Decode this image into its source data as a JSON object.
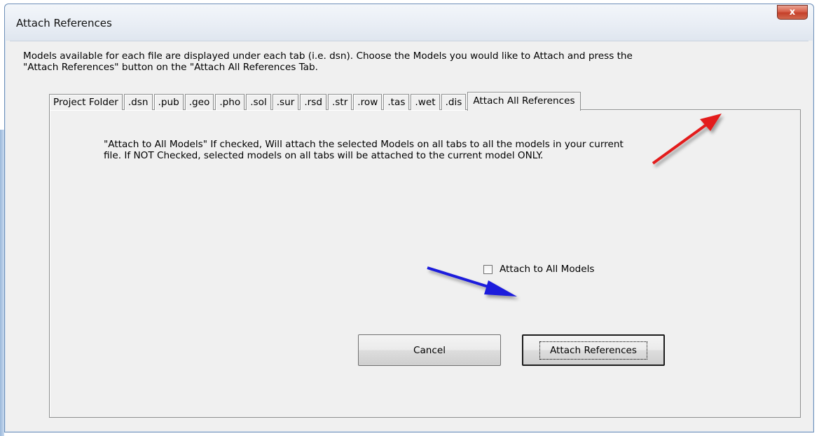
{
  "window": {
    "title": "Attach References",
    "close_label": "x"
  },
  "instructions": "Models available for each file are displayed under each tab (i.e. dsn).  Choose the Models you would like to Attach and press the\n\"Attach References\" button on the \"Attach All References Tab.",
  "tabs": [
    {
      "label": "Project Folder"
    },
    {
      "label": ".dsn"
    },
    {
      "label": ".pub"
    },
    {
      "label": ".geo"
    },
    {
      "label": ".pho"
    },
    {
      "label": ".sol"
    },
    {
      "label": ".sur"
    },
    {
      "label": ".rsd"
    },
    {
      "label": ".str"
    },
    {
      "label": ".row"
    },
    {
      "label": ".tas"
    },
    {
      "label": ".wet"
    },
    {
      "label": ".dis"
    },
    {
      "label": "Attach All References",
      "active": true
    }
  ],
  "panel": {
    "description": "\"Attach to All Models\" If checked, Will attach the selected Models on all tabs to all the models in your current file.   If NOT Checked, selected models on all tabs will be attached to the current model ONLY.",
    "checkbox_label": "Attach to All Models",
    "checkbox_checked": false,
    "cancel_label": "Cancel",
    "attach_label": "Attach References"
  },
  "annotations": {
    "red_arrow_color": "#e31b1b",
    "blue_arrow_color": "#1b1bdc"
  }
}
